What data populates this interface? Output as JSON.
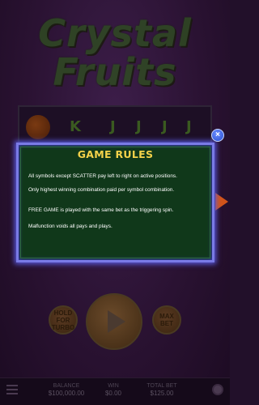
{
  "game": {
    "logo_line1": "Crystal",
    "logo_line2": "Fruits"
  },
  "reels": {
    "symbols": [
      "K",
      "J",
      "J",
      "J",
      "J"
    ]
  },
  "modal": {
    "title": "GAME RULES",
    "rules": [
      "All symbols except SCATTER pay left to right on active positions.",
      "Only highest winning combination paid per symbol combination.",
      "FREE GAME is played with the same bet as the triggering spin.",
      "Malfunction voids all pays and plays."
    ],
    "close_symbol": "×"
  },
  "controls": {
    "hold_label": "HOLD FOR TURBO",
    "max_label": "MAX BET"
  },
  "footer": {
    "balance_label": "BALANCE",
    "balance_value": "$100,000.00",
    "win_label": "WIN",
    "win_value": "$0.00",
    "bet_label": "TOTAL BET",
    "bet_value": "$125.00"
  },
  "colors": {
    "modal_bg": "#10381a",
    "modal_border": "#7a7ae6",
    "title": "#f5d24a"
  }
}
